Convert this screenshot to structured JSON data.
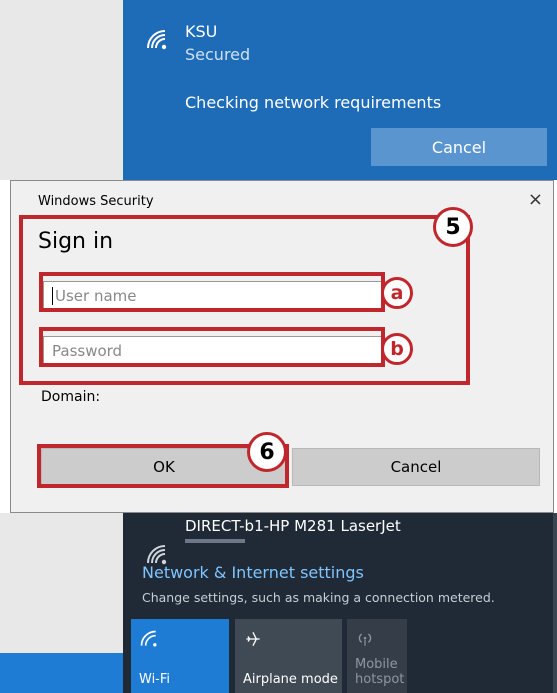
{
  "top_flyout": {
    "ssid": "KSU",
    "status": "Secured",
    "message": "Checking network requirements",
    "cancel_label": "Cancel"
  },
  "dialog": {
    "window_title": "Windows Security",
    "close_glyph": "×",
    "heading": "Sign in",
    "username_placeholder": "User name",
    "password_placeholder": "Password",
    "domain_label": "Domain:",
    "ok_label": "OK",
    "cancel_label": "Cancel"
  },
  "annotations": {
    "step_5": "5",
    "step_6": "6",
    "label_a": "a",
    "label_b": "b"
  },
  "bottom_flyout": {
    "network_name": "DIRECT-b1-HP M281 LaserJet",
    "settings_link": "Network & Internet settings",
    "settings_desc": "Change settings, such as making a connection metered.",
    "tiles": [
      {
        "label": "Wi-Fi",
        "icon": "wifi-icon"
      },
      {
        "label": "Airplane mode",
        "icon": "airplane-icon"
      },
      {
        "label": "Mobile hotspot",
        "line1": "Mobile",
        "line2": "hotspot",
        "icon": "hotspot-icon"
      }
    ]
  },
  "colors": {
    "annotation_red": "#c0272d",
    "flyout_blue": "#1e6bb8",
    "flyout_dark": "#1f2a36",
    "link_blue": "#7fc4ff"
  }
}
